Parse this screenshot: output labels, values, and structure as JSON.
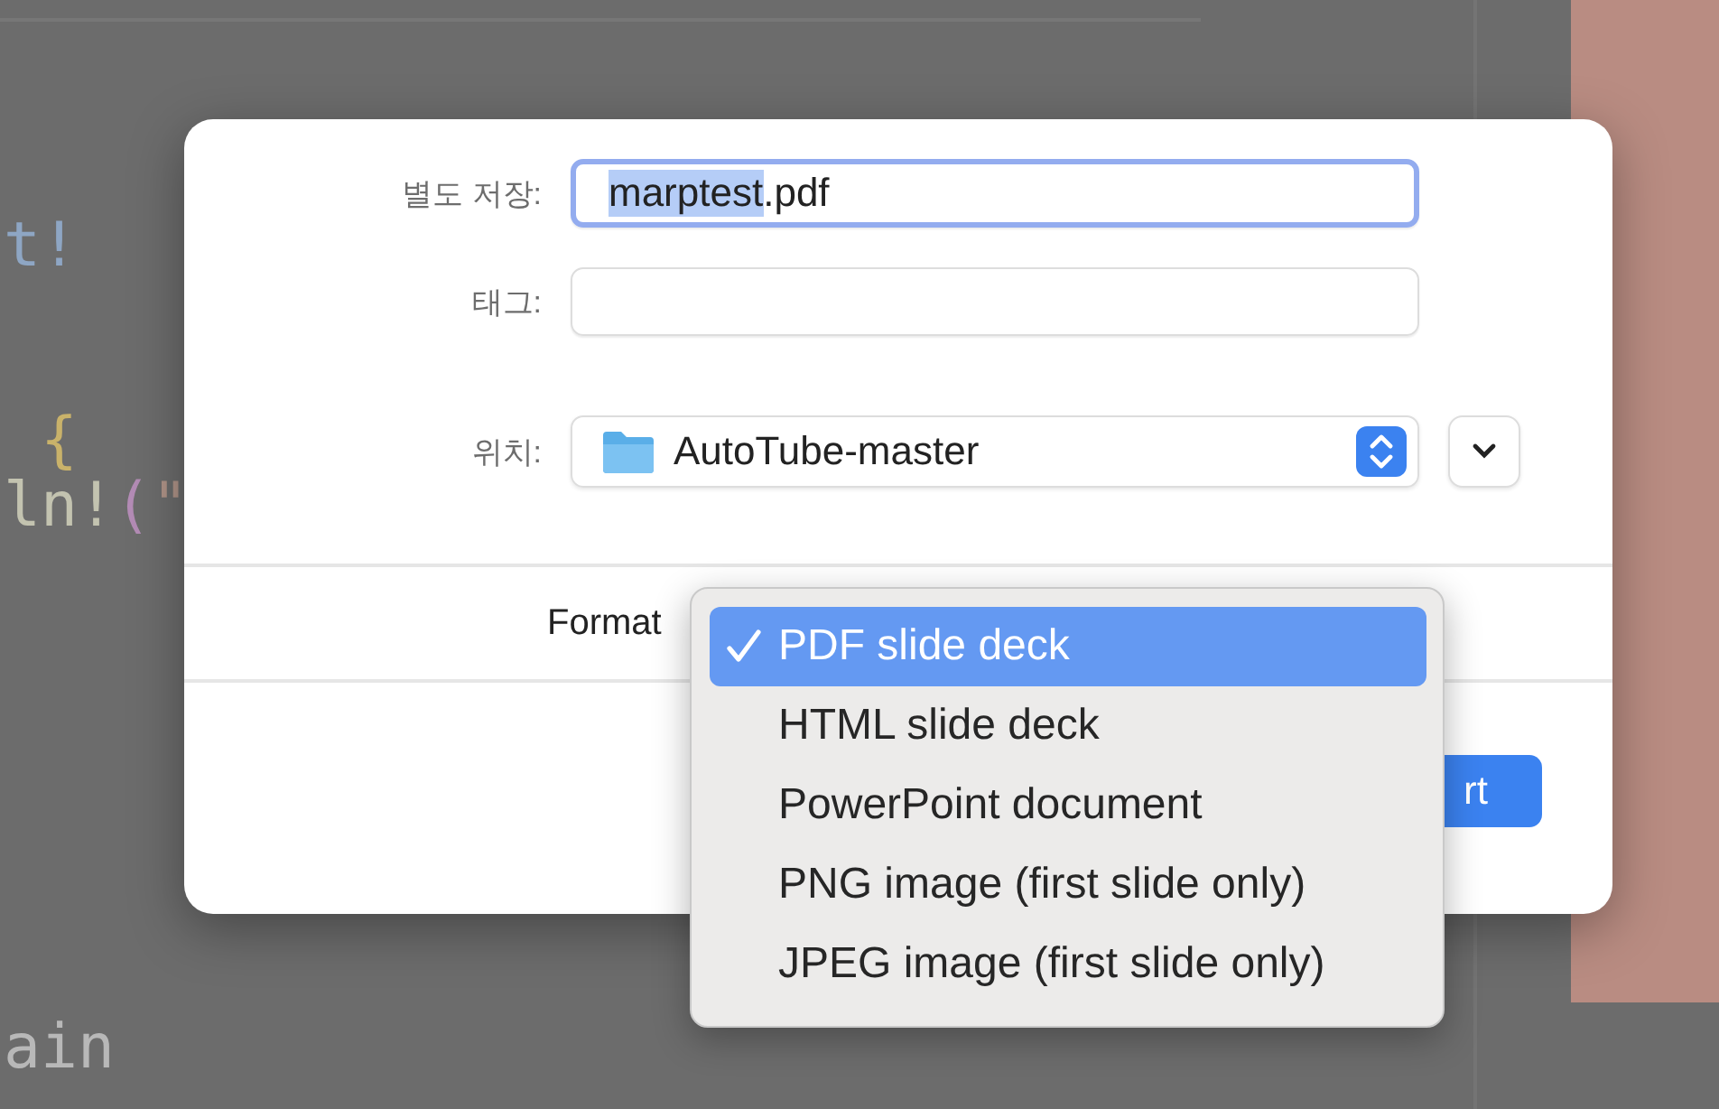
{
  "background_code": [
    {
      "segments": [
        {
          "text": "t!",
          "color": "#8ea6c4"
        }
      ]
    },
    {
      "segments": [
        {
          "text": " {",
          "color": "#c9b26a"
        }
      ]
    },
    {
      "segments": [
        {
          "text": "ln!",
          "color": "#c3c3b0"
        },
        {
          "text": "(",
          "color": "#b48cb6"
        },
        {
          "text": "\"",
          "color": "#b09488"
        }
      ]
    },
    {
      "segments": [
        {
          "text": "ain",
          "color": "#b8b8b8"
        }
      ]
    }
  ],
  "dialog": {
    "save_as": {
      "label": "별도 저장:",
      "selected_text": "marptest",
      "text_after_selection": ".pdf",
      "focused": true
    },
    "tags": {
      "label": "태그:"
    },
    "location": {
      "label": "위치:",
      "folder": "AutoTube-master"
    },
    "format": {
      "label": "Format"
    },
    "primary_button": {
      "label": "rt"
    }
  },
  "format_menu": [
    {
      "label": "PDF slide deck",
      "selected": true
    },
    {
      "label": "HTML slide deck",
      "selected": false
    },
    {
      "label": "PowerPoint document",
      "selected": false
    },
    {
      "label": "PNG image (first slide only)",
      "selected": false
    },
    {
      "label": "JPEG image (first slide only)",
      "selected": false
    }
  ]
}
